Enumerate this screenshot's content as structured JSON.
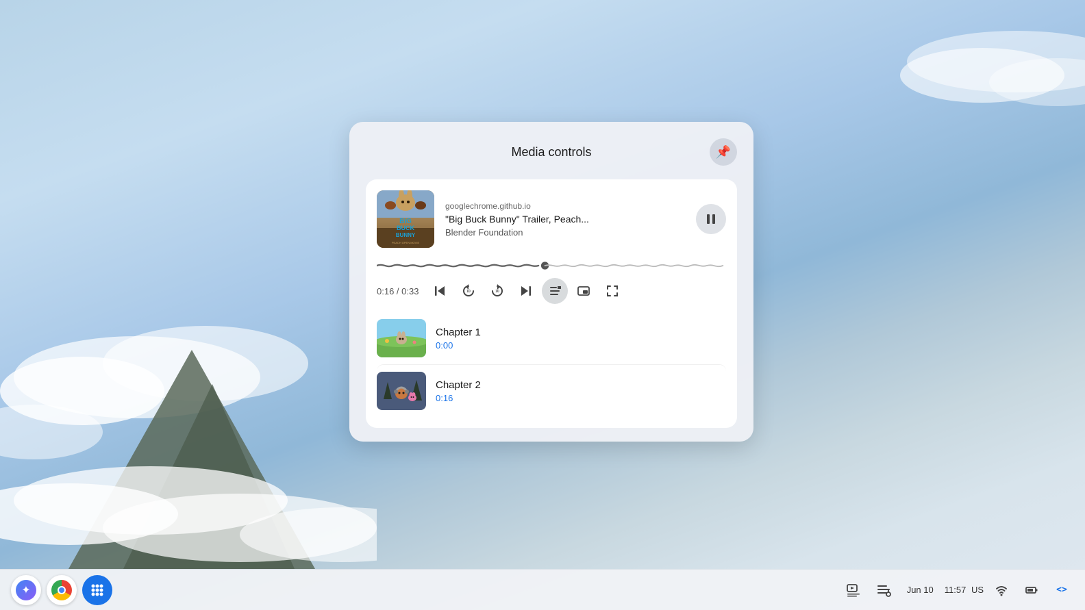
{
  "desktop": {
    "background_gradient": "sky blue with mountain"
  },
  "media_panel": {
    "title": "Media controls",
    "pin_button_label": "📌",
    "media_card": {
      "source": "googlechrome.github.io",
      "title": "\"Big Buck Bunny\" Trailer, Peach...",
      "artist": "Blender Foundation",
      "time_current": "0:16",
      "time_total": "0:33",
      "time_display": "0:16 / 0:33",
      "progress_percent": 48
    },
    "controls": {
      "skip_back_label": "⏮",
      "rewind_label": "↺10",
      "forward_label": "↻10",
      "skip_next_label": "⏭",
      "chapters_label": "≣",
      "pip_label": "⧉",
      "fullscreen_label": "⛶",
      "pause_label": "⏸"
    },
    "chapters": [
      {
        "name": "Chapter 1",
        "time": "0:00"
      },
      {
        "name": "Chapter 2",
        "time": "0:16"
      }
    ]
  },
  "taskbar": {
    "apps": [
      {
        "name": "Assistant",
        "icon": "✦"
      },
      {
        "name": "Chrome",
        "icon": "chrome"
      },
      {
        "name": "App Launcher",
        "icon": "⋮⋮⋮"
      }
    ],
    "system": {
      "date": "Jun 10",
      "time": "11:57",
      "locale": "US",
      "media_icon": "🎵",
      "battery_icon": "🔋",
      "code_icon": "<>"
    }
  }
}
